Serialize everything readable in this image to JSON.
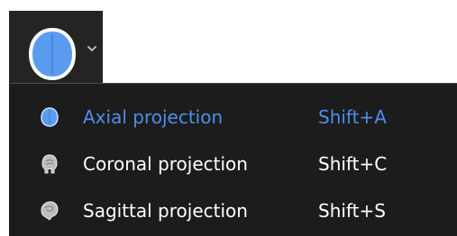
{
  "toolbar": {
    "button_icon": "brain-axial-icon",
    "dropdown_icon": "chevron-down-icon"
  },
  "menu": {
    "items": [
      {
        "label": "Axial projection",
        "shortcut": "Shift+A",
        "icon": "brain-axial-icon",
        "active": true
      },
      {
        "label": "Coronal projection",
        "shortcut": "Shift+C",
        "icon": "brain-coronal-icon",
        "active": false
      },
      {
        "label": "Sagittal projection",
        "shortcut": "Shift+S",
        "icon": "brain-sagittal-icon",
        "active": false
      }
    ]
  },
  "colors": {
    "accent": "#4d8fe8",
    "menu_bg": "#1c1c1c",
    "button_bg": "#242424",
    "text": "#ffffff"
  }
}
